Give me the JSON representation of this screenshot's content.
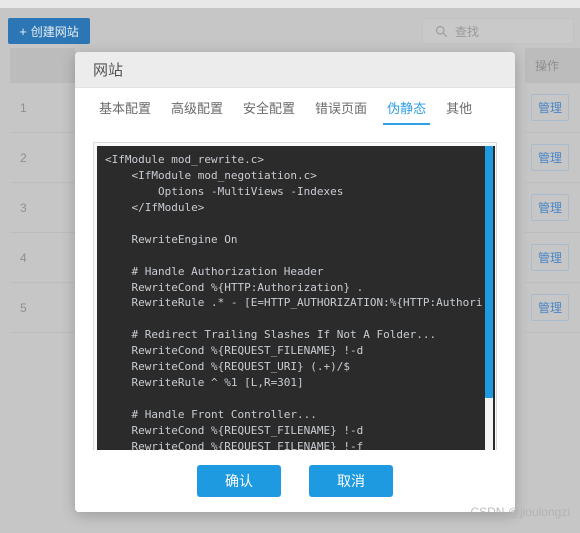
{
  "toolbar": {
    "create_button_label": "创建网站",
    "create_button_icon": "plus-icon",
    "search_placeholder": "查找",
    "search_icon": "search-icon"
  },
  "background_table": {
    "index_header": "",
    "action_header": "操作",
    "rows": [
      {
        "index": "1",
        "action_label": "管理"
      },
      {
        "index": "2",
        "action_label": "管理"
      },
      {
        "index": "3",
        "action_label": "管理"
      },
      {
        "index": "4",
        "action_label": "管理"
      },
      {
        "index": "5",
        "action_label": "管理"
      }
    ]
  },
  "modal": {
    "title": "网站",
    "tabs": [
      {
        "label": "基本配置",
        "active": false
      },
      {
        "label": "高级配置",
        "active": false
      },
      {
        "label": "安全配置",
        "active": false
      },
      {
        "label": "错误页面",
        "active": false
      },
      {
        "label": "伪静态",
        "active": true
      },
      {
        "label": "其他",
        "active": false
      }
    ],
    "editor": {
      "content": "<IfModule mod_rewrite.c>\n    <IfModule mod_negotiation.c>\n        Options -MultiViews -Indexes\n    </IfModule>\n\n    RewriteEngine On\n\n    # Handle Authorization Header\n    RewriteCond %{HTTP:Authorization} .\n    RewriteRule .* - [E=HTTP_AUTHORIZATION:%{HTTP:Authori\n\n    # Redirect Trailing Slashes If Not A Folder...\n    RewriteCond %{REQUEST_FILENAME} !-d\n    RewriteCond %{REQUEST_URI} (.+)/$\n    RewriteRule ^ %1 [L,R=301]\n\n    # Handle Front Controller...\n    RewriteCond %{REQUEST_FILENAME} !-d\n    RewriteCond %{REQUEST_FILENAME} !-f"
    },
    "confirm_label": "确认",
    "cancel_label": "取消"
  },
  "watermark": "CSDN @jioulongzi",
  "colors": {
    "primary_blue": "#1e9ae0",
    "create_button_blue": "#2d76b5",
    "active_tab_blue": "#2f9fe8",
    "manage_link_blue": "#4a86c7",
    "editor_background": "#2b2b2b",
    "editor_text": "#c8cdd3",
    "page_background": "#c6c6c6"
  }
}
